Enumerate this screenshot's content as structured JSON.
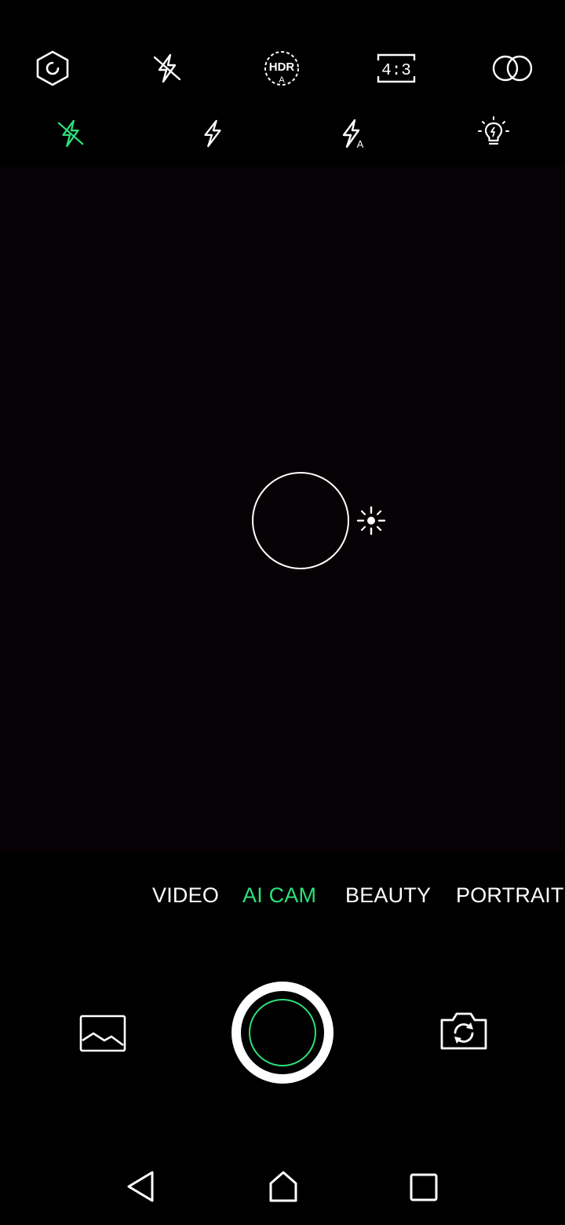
{
  "top_toolbar": {
    "items": [
      {
        "name": "settings-icon"
      },
      {
        "name": "flash-off-icon"
      },
      {
        "name": "hdr-auto-icon",
        "label": "HDR",
        "sublabel": "A"
      },
      {
        "name": "aspect-ratio-icon",
        "label": "4:3"
      },
      {
        "name": "filter-icon"
      }
    ]
  },
  "flash_options": {
    "items": [
      {
        "name": "flash-off-option-icon",
        "state": "selected"
      },
      {
        "name": "flash-on-option-icon"
      },
      {
        "name": "flash-auto-option-icon",
        "sublabel": "A"
      },
      {
        "name": "torch-option-icon"
      }
    ]
  },
  "modes": {
    "items": [
      {
        "label": "VIDEO"
      },
      {
        "label": "AI CAM",
        "active": true
      },
      {
        "label": "BEAUTY"
      },
      {
        "label": "PORTRAIT"
      }
    ]
  },
  "colors": {
    "accent": "#2ee07a",
    "background": "#000000",
    "viewfinder": "#050104",
    "foreground": "#ffffff"
  },
  "bottom_controls": {
    "gallery": "gallery-icon",
    "shutter": "shutter-button",
    "switch_camera": "switch-camera-icon"
  },
  "nav_bar": {
    "items": [
      "back-icon",
      "home-icon",
      "recents-icon"
    ]
  }
}
